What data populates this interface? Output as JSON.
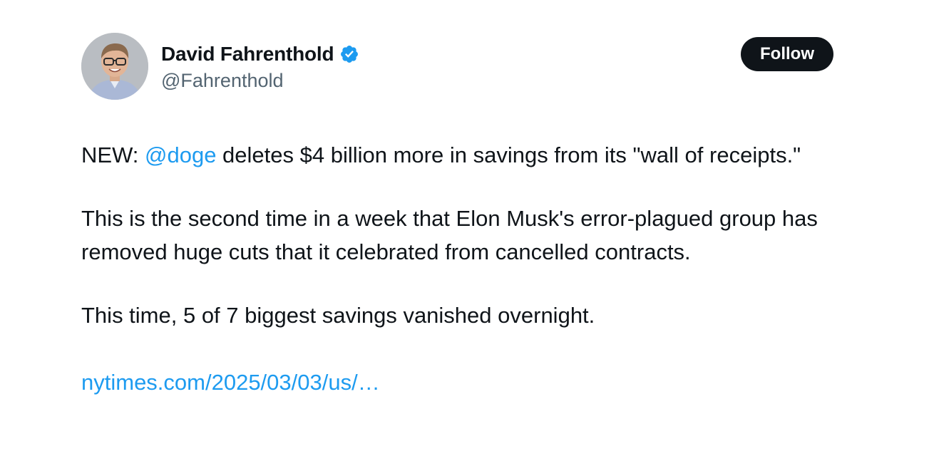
{
  "author": {
    "display_name": "David Fahrenthold",
    "handle": "@Fahrenthold",
    "verified_icon": "verified-badge-icon",
    "avatar_icon": "avatar"
  },
  "actions": {
    "follow_label": "Follow"
  },
  "tweet": {
    "p1_prefix": "NEW: ",
    "p1_mention": "@doge",
    "p1_rest": " deletes $4 billion more in savings from its \"wall of receipts.\"",
    "p2": "This is the second time in a week that Elon Musk's error-plagued group has removed huge cuts that it celebrated from cancelled contracts.",
    "p3": "This time, 5 of 7 biggest savings vanished overnight.",
    "link": "nytimes.com/2025/03/03/us/…"
  },
  "colors": {
    "accent": "#1d9bf0",
    "text": "#0f1419",
    "secondary": "#536471",
    "button_bg": "#0f1419"
  }
}
